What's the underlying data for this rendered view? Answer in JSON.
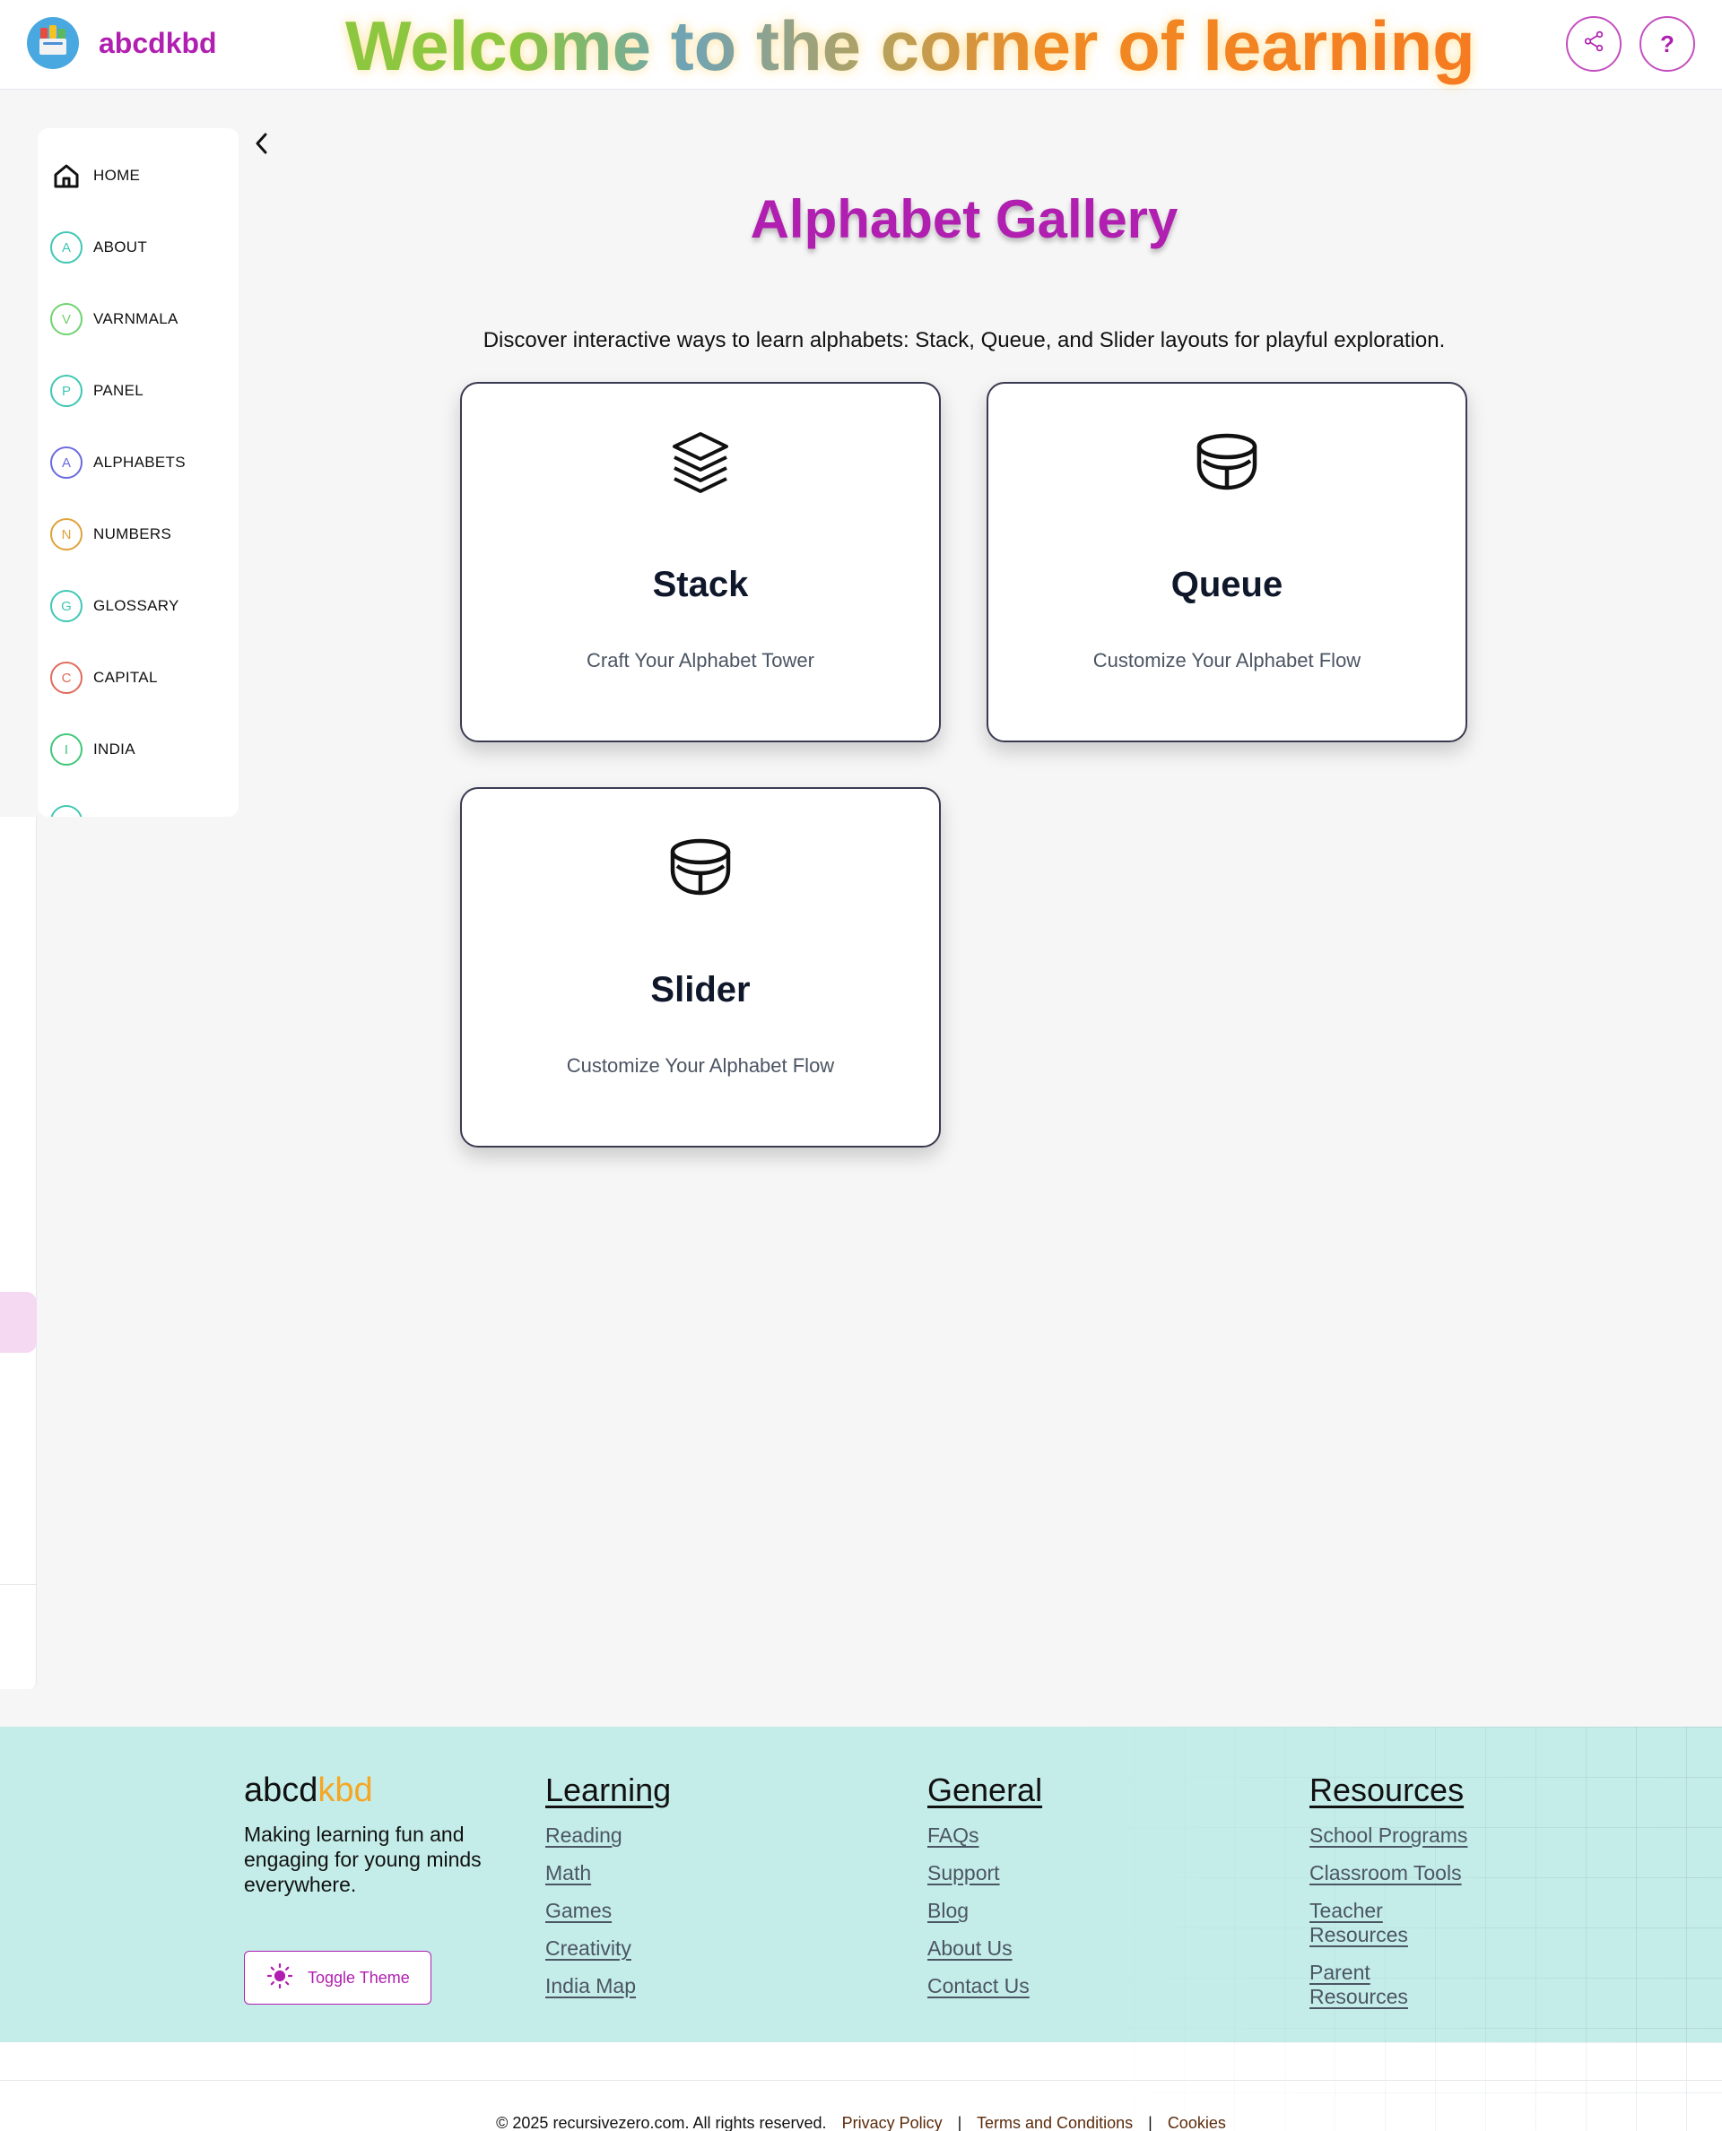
{
  "header": {
    "brand": "abcdkbd",
    "welcome": "Welcome to the corner of learning",
    "help_label": "?"
  },
  "sidebar": {
    "items": [
      {
        "icon": "H",
        "label": "HOME",
        "color": "#111111"
      },
      {
        "icon": "A",
        "label": "ABOUT",
        "color": "#3fc7b4"
      },
      {
        "icon": "V",
        "label": "VARNMALA",
        "color": "#6fd36f"
      },
      {
        "icon": "P",
        "label": "PANEL",
        "color": "#3fc7b4"
      },
      {
        "icon": "A",
        "label": "ALPHABETS",
        "color": "#6a6adf"
      },
      {
        "icon": "N",
        "label": "NUMBERS",
        "color": "#e0a23a"
      },
      {
        "icon": "G",
        "label": "GLOSSARY",
        "color": "#3fc7b4"
      },
      {
        "icon": "C",
        "label": "CAPITAL",
        "color": "#e06a5a"
      },
      {
        "icon": "I",
        "label": "INDIA",
        "color": "#3fc77a"
      }
    ]
  },
  "main": {
    "title": "Alphabet Gallery",
    "description": "Discover interactive ways to learn alphabets: Stack, Queue, and Slider layouts for playful exploration.",
    "cards": [
      {
        "title": "Stack",
        "subtitle": "Craft Your Alphabet Tower",
        "icon": "layers-icon"
      },
      {
        "title": "Queue",
        "subtitle": "Customize Your Alphabet Flow",
        "icon": "bowl-icon"
      },
      {
        "title": "Slider",
        "subtitle": "Customize Your Alphabet Flow",
        "icon": "bowl-icon"
      }
    ]
  },
  "footer": {
    "brand_main": "abcd",
    "brand_accent": "kbd",
    "tagline": "Making learning fun and engaging for young minds everywhere.",
    "toggle_label": "Toggle Theme",
    "learning": {
      "heading": "Learning",
      "links": [
        "Reading",
        "Math",
        "Games",
        "Creativity",
        "India Map"
      ]
    },
    "general": {
      "heading": "General",
      "links": [
        "FAQs",
        "Support",
        "Blog",
        "About Us",
        "Contact Us"
      ]
    },
    "resources": {
      "heading": "Resources",
      "links": [
        "School Programs",
        "Classroom Tools",
        "Teacher Resources",
        "Parent Resources"
      ]
    },
    "copyright": "© 2025 recursivezero.com. All rights reserved.",
    "legal": [
      "Privacy Policy",
      "Terms and Conditions",
      "Cookies"
    ],
    "separator": "|"
  },
  "colors": {
    "brand": "#b01fb0",
    "accent": "#f6a623",
    "footer_bg": "#c4ede9"
  }
}
